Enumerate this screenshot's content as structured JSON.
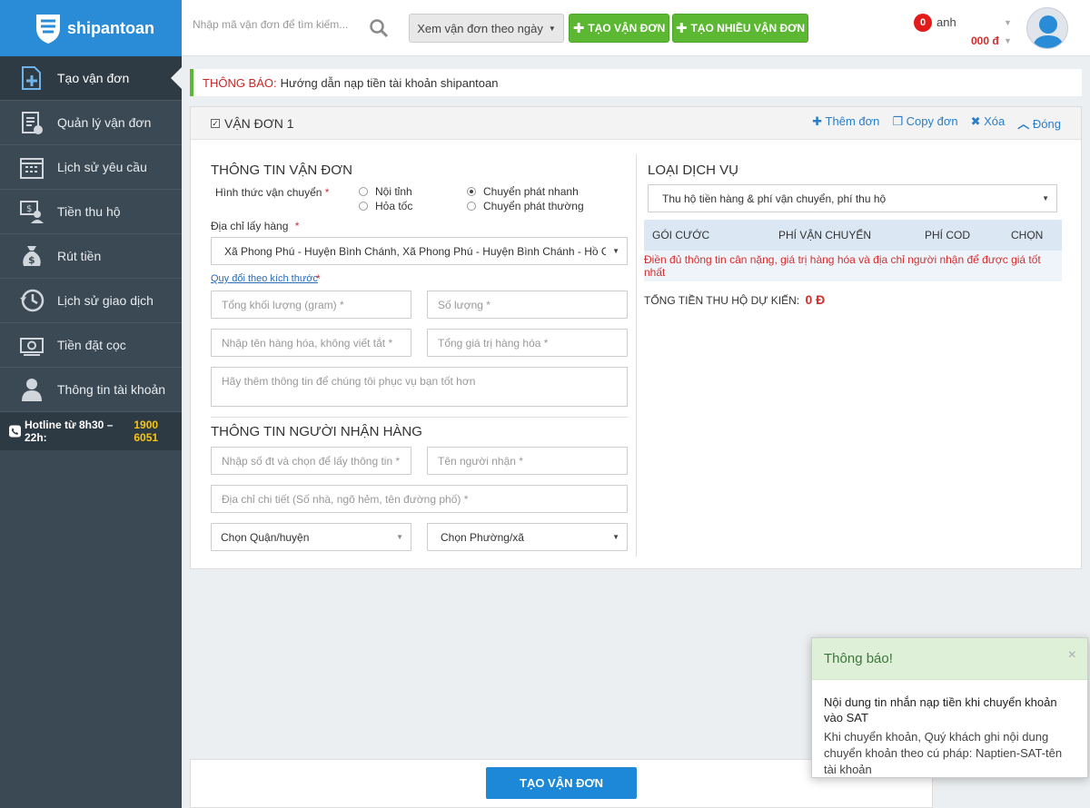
{
  "app": {
    "brand": "shipantoan"
  },
  "sidebar": {
    "items": [
      {
        "label": "Tạo vận đơn",
        "icon": "add-document-icon"
      },
      {
        "label": "Quản lý vận đơn",
        "icon": "clipboard-check-icon"
      },
      {
        "label": "Lịch sử yêu cầu",
        "icon": "calendar-icon"
      },
      {
        "label": "Tiền thu hộ",
        "icon": "cash-collect-icon"
      },
      {
        "label": "Rút tiền",
        "icon": "money-bag-icon"
      },
      {
        "label": "Lịch sử giao dịch",
        "icon": "history-icon"
      },
      {
        "label": "Tiền đặt cọc",
        "icon": "deposit-icon"
      },
      {
        "label": "Thông tin tài khoản",
        "icon": "user-icon"
      }
    ],
    "hotline_label": "Hotline từ 8h30 – 22h:",
    "hotline_number": "1900 6051"
  },
  "topbar": {
    "search_placeholder": "Nhập mã vận đơn để tìm kiếm...",
    "view_by_date": "Xem vận đơn theo ngày",
    "create_order": "TẠO VẬN ĐƠN",
    "create_many": "TẠO NHIỀU VẬN ĐƠN",
    "badge_count": "0",
    "user_name": "anh",
    "balance": "000 đ"
  },
  "notice": {
    "label": "THÔNG BÁO:",
    "text": "Hướng dẫn nạp tiền tài khoản shipantoan"
  },
  "order": {
    "title": "VẬN ĐƠN 1",
    "actions": {
      "add": "Thêm đơn",
      "copy": "Copy đơn",
      "delete": "Xóa",
      "close": "Đóng"
    },
    "shipping_info": {
      "title": "THÔNG TIN VẬN ĐƠN",
      "method_label": "Hình thức vận chuyển",
      "options": [
        "Nội tỉnh",
        "Chuyển phát nhanh",
        "Hỏa tốc",
        "Chuyển phát thường"
      ],
      "selected": "Chuyển phát nhanh",
      "pickup_label": "Địa chỉ lấy hàng",
      "pickup_value": "Xã Phong Phú - Huyện Bình Chánh, Xã Phong Phú - Huyện Bình Chánh - Hồ Chí Mi",
      "convert_link": "Quy đổi theo kích thước",
      "weight_ph": "Tổng khối lượng (gram) *",
      "qty_ph": "Số lượng *",
      "goods_name_ph": "Nhập tên hàng hóa, không viết tắt *",
      "goods_value_ph": "Tổng giá trị hàng hóa *",
      "note_ph": "Hãy thêm thông tin để chúng tôi phục vụ bạn tốt hơn"
    },
    "receiver": {
      "title": "THÔNG TIN NGƯỜI NHẬN HÀNG",
      "phone_ph": "Nhập số đt và chọn để lấy thông tin *",
      "name_ph": "Tên người nhận *",
      "address_ph": "Địa chỉ chi tiết (Số nhà, ngõ hẻm, tên đường phố) *",
      "district": "Chọn Quận/huyện",
      "ward": "Chọn Phường/xã"
    },
    "service": {
      "title": "LOẠI DỊCH VỤ",
      "selected": "Thu hộ tiền hàng & phí vận chuyển, phí thu hộ",
      "columns": [
        "GÓI CƯỚC",
        "PHÍ VẬN CHUYỂN",
        "PHÍ COD",
        "CHỌN"
      ],
      "hint": "Điền đủ thông tin cân nặng, giá trị hàng hóa và địa chỉ người nhận để được giá tốt nhất",
      "total_label": "TỔNG TIỀN THU HỘ DỰ KIẾN:",
      "total_value": "0 Đ"
    }
  },
  "submit_label": "TẠO VẬN ĐƠN",
  "toast": {
    "header": "Thông báo!",
    "title": "Nội dung tin nhắn nạp tiền khi chuyển khoản vào SAT",
    "body": "Khi chuyển khoản, Quý khách ghi nội dung chuyển khoản theo cú pháp: Naptien-SAT-tên tài khoản"
  },
  "colors": {
    "primary": "#2a8cd6",
    "sidebar": "#3b4954",
    "green": "#5cb833",
    "red": "#d32f2f"
  }
}
